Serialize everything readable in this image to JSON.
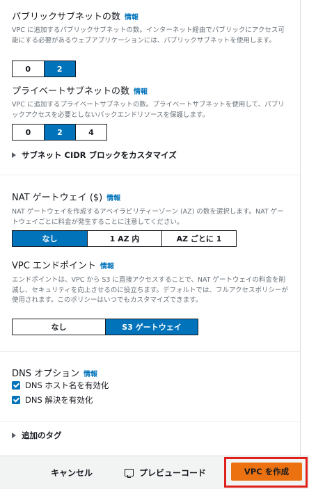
{
  "public_subnets": {
    "title": "パブリックサブネットの数",
    "info": "情報",
    "description": "VPC に追加するパブリックサブネットの数。インターネット経由でパブリックにアクセス可能にする必要があるウェブアプリケーションには、パブリックサブネットを使用します。",
    "options": [
      "0",
      "2"
    ],
    "selected": "2"
  },
  "private_subnets": {
    "title": "プライベートサブネットの数",
    "info": "情報",
    "description": "VPC に追加するプライベートサブネットの数。プライベートサブネットを使用して、パブリックアクセスを必要としないバックエンドリソースを保護します。",
    "options": [
      "0",
      "2",
      "4"
    ],
    "selected": "2"
  },
  "cidr_expander": {
    "label": "サブネット CIDR ブロックをカスタマイズ"
  },
  "nat_gateway": {
    "title": "NAT ゲートウェイ ($)",
    "info": "情報",
    "description": "NAT ゲートウェイを作成するアベイラビリティーゾーン (AZ) の数を選択します。NAT ゲートウェイごとに料金が発生することに注意してください。",
    "options": [
      "なし",
      "1 AZ 内",
      "AZ ごとに 1"
    ],
    "selected": "なし"
  },
  "vpc_endpoints": {
    "title": "VPC エンドポイント",
    "info": "情報",
    "description": "エンドポイントは、VPC から S3 に直接アクセスすることで、NAT ゲートウェイの料金を削減し、セキュリティを向上させるのに役立ちます。デフォルトでは、フルアクセスポリシーが使用されます。このポリシーはいつでもカスタマイズできます。",
    "options": [
      "なし",
      "S3 ゲートウェイ"
    ],
    "selected": "S3 ゲートウェイ"
  },
  "dns_options": {
    "title": "DNS オプション",
    "info": "情報",
    "hostnames_label": "DNS ホスト名を有効化",
    "resolution_label": "DNS 解決を有効化",
    "hostnames_checked": true,
    "resolution_checked": true
  },
  "tags_expander": {
    "label": "追加のタグ"
  },
  "footer": {
    "cancel_label": "キャンセル",
    "preview_label": "プレビューコード",
    "create_label": "VPC を作成"
  },
  "colors": {
    "selected": "#0073bb",
    "primary_button": "#ec7211",
    "highlight_box": "#e0201a",
    "info_link": "#0073bb"
  }
}
